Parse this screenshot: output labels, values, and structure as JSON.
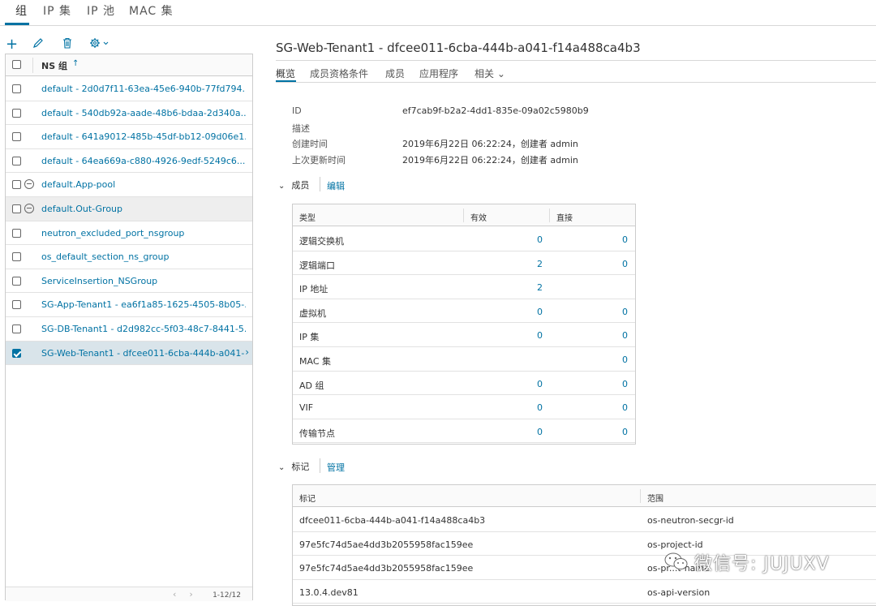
{
  "top_tabs": [
    "组",
    "IP 集",
    "IP 池",
    "MAC 集"
  ],
  "left": {
    "header": "NS 组",
    "rows": [
      {
        "label": "default - 2d0d7f11-63ea-45e6-940b-77fd794...",
        "type": "normal"
      },
      {
        "label": "default - 540db92a-aade-48b6-bdaa-2d340a...",
        "type": "normal"
      },
      {
        "label": "default - 641a9012-485b-45df-bb12-09d06e1...",
        "type": "normal"
      },
      {
        "label": "default - 64ea669a-c880-4926-9edf-5249c6...",
        "type": "normal"
      },
      {
        "label": "default.App-pool",
        "type": "minus"
      },
      {
        "label": "default.Out-Group",
        "type": "minus"
      },
      {
        "label": "neutron_excluded_port_nsgroup",
        "type": "normal"
      },
      {
        "label": "os_default_section_ns_group",
        "type": "normal"
      },
      {
        "label": "ServiceInsertion_NSGroup",
        "type": "normal"
      },
      {
        "label": "SG-App-Tenant1 - ea6f1a85-1625-4505-8b05-...",
        "type": "normal"
      },
      {
        "label": "SG-DB-Tenant1 - d2d982cc-5f03-48c7-8441-5...",
        "type": "normal"
      },
      {
        "label": "SG-Web-Tenant1 - dfcee011-6cba-444b-a041-...",
        "type": "selected"
      }
    ],
    "pager": "1-12/12"
  },
  "detail": {
    "title": "SG-Web-Tenant1 - dfcee011-6cba-444b-a041-f14a488ca4b3",
    "tabs": [
      "概览",
      "成员资格条件",
      "成员",
      "应用程序",
      "相关 ⌄"
    ],
    "fields": [
      {
        "label": "ID",
        "value": "ef7cab9f-b2a2-4dd1-835e-09a02c5980b9"
      },
      {
        "label": "描述",
        "value": ""
      },
      {
        "label": "创建时间",
        "value": "2019年6月22日 06:22:24，创建者 admin"
      },
      {
        "label": "上次更新时间",
        "value": "2019年6月22日 06:22:24，创建者 admin"
      }
    ],
    "members_section": {
      "title": "成员",
      "action": "编辑"
    },
    "members_table": {
      "headers": [
        "类型",
        "有效",
        "直接"
      ],
      "rows": [
        {
          "type": "逻辑交换机",
          "effective": "0",
          "direct": "0"
        },
        {
          "type": "逻辑端口",
          "effective": "2",
          "direct": "0"
        },
        {
          "type": "IP 地址",
          "effective": "2",
          "direct": ""
        },
        {
          "type": "虚拟机",
          "effective": "0",
          "direct": "0"
        },
        {
          "type": "IP 集",
          "effective": "0",
          "direct": "0"
        },
        {
          "type": "MAC 集",
          "effective": "",
          "direct": "0"
        },
        {
          "type": "AD 组",
          "effective": "0",
          "direct": "0"
        },
        {
          "type": "VIF",
          "effective": "0",
          "direct": "0"
        },
        {
          "type": "传输节点",
          "effective": "0",
          "direct": "0"
        }
      ]
    },
    "tags_section": {
      "title": "标记",
      "action": "管理"
    },
    "tags_table": {
      "headers": [
        "标记",
        "范围"
      ],
      "rows": [
        {
          "tag": "dfcee011-6cba-444b-a041-f14a488ca4b3",
          "scope": "os-neutron-secgr-id"
        },
        {
          "tag": "97e5fc74d5ae4dd3b2055958fac159ee",
          "scope": "os-project-id"
        },
        {
          "tag": "97e5fc74d5ae4dd3b2055958fac159ee",
          "scope": "os-pr...t-name"
        },
        {
          "tag": "13.0.4.dev81",
          "scope": "os-api-version"
        }
      ]
    }
  },
  "watermark": "微信号: JUJUXV",
  "colors": {
    "accent": "#0072a3",
    "selected_row": "#d9e4ea",
    "border": "#cccccc"
  }
}
